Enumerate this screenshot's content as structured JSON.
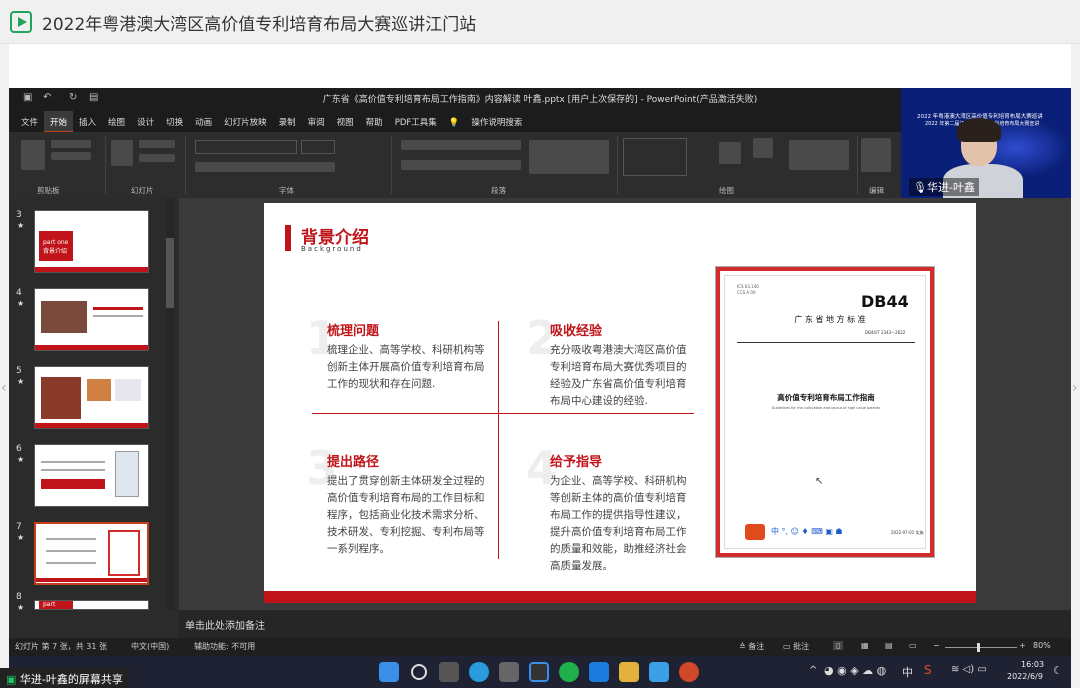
{
  "window_title": "2022年粤港澳大湾区高价值专利培育布局大赛巡讲江门站",
  "ppt": {
    "doc_title": "广东省《高价值专利培育布局工作指南》内容解读 叶鑫.pptx [用户上次保存的] - PowerPoint(产品激活失败)",
    "tabs": [
      "文件",
      "开始",
      "插入",
      "绘图",
      "设计",
      "切换",
      "动画",
      "幻灯片放映",
      "录制",
      "审阅",
      "视图",
      "帮助",
      "PDF工具集"
    ],
    "tell_me": "操作说明搜索",
    "groups": [
      "剪贴板",
      "幻灯片",
      "字体",
      "段落",
      "绘图",
      "编辑"
    ]
  },
  "webcam": {
    "title_line1": "2022 年粤港澳大湾区高价值专利培育布局大赛巡讲",
    "title_line2": "2022 年第二届江门市高价值专利培育布局大赛宣讲",
    "name_label": "华进-叶鑫"
  },
  "thumbnails": [
    {
      "num": "3",
      "star": "★",
      "text": "part one 背景介绍"
    },
    {
      "num": "4",
      "star": "★",
      "text": ""
    },
    {
      "num": "5",
      "star": "★",
      "text": ""
    },
    {
      "num": "6",
      "star": "★",
      "text": ""
    },
    {
      "num": "7",
      "star": "★",
      "text": ""
    },
    {
      "num": "8",
      "star": "★",
      "text": "part"
    }
  ],
  "slide": {
    "title": "背景介绍",
    "subtitle": "Background",
    "quadrants": [
      {
        "num": "1",
        "heading": "梳理问题",
        "body": "梳理企业、高等学校、科研机构等创新主体开展高价值专利培育布局工作的现状和存在问题."
      },
      {
        "num": "2",
        "heading": "吸收经验",
        "body": "充分吸收粤港澳大湾区高价值专利培育布局大赛优秀项目的经验及广东省高价值专利培育布局中心建设的经验."
      },
      {
        "num": "3",
        "heading": "提出路径",
        "body": "提出了贯穿创新主体研发全过程的高价值专利培育布局的工作目标和程序，包括商业化技术需求分析、技术研发、专利挖掘、专利布局等一系列程序。"
      },
      {
        "num": "4",
        "heading": "给予指导",
        "body": "为企业、高等学校、科研机构等创新主体的高价值专利培育布局工作的提供指导性建议，提升高价值专利培育布局工作的质量和效能，助推经济社会高质量发展。"
      }
    ],
    "standard": {
      "code_top": "ICS 03.140",
      "code_top2": "CCS A 00",
      "db": "DB44",
      "province": "广  东  省  地  方  标  准",
      "std_no": "DB44/T 2343—2022",
      "name_cn": "高价值专利培育布局工作指南",
      "name_en": "Guidelines for the cultivation and layout of high value patents",
      "date": "2022-07-01 实施"
    }
  },
  "notes_placeholder": "单击此处添加备注",
  "status": {
    "slide_info": "幻灯片 第 7 张，共 31 张",
    "language": "中文(中国)",
    "accessibility": "辅助功能: 不可用",
    "notes": "备注",
    "comments": "批注",
    "zoom": "80%"
  },
  "taskbar": {
    "ime": "中",
    "time": "16:03",
    "date": "2022/6/9"
  },
  "share_label": "华进-叶鑫的屏幕共享",
  "colors": {
    "accent_red": "#c0141a",
    "ppt_accent": "#c43e1c",
    "taskbar": "#1e2233"
  }
}
